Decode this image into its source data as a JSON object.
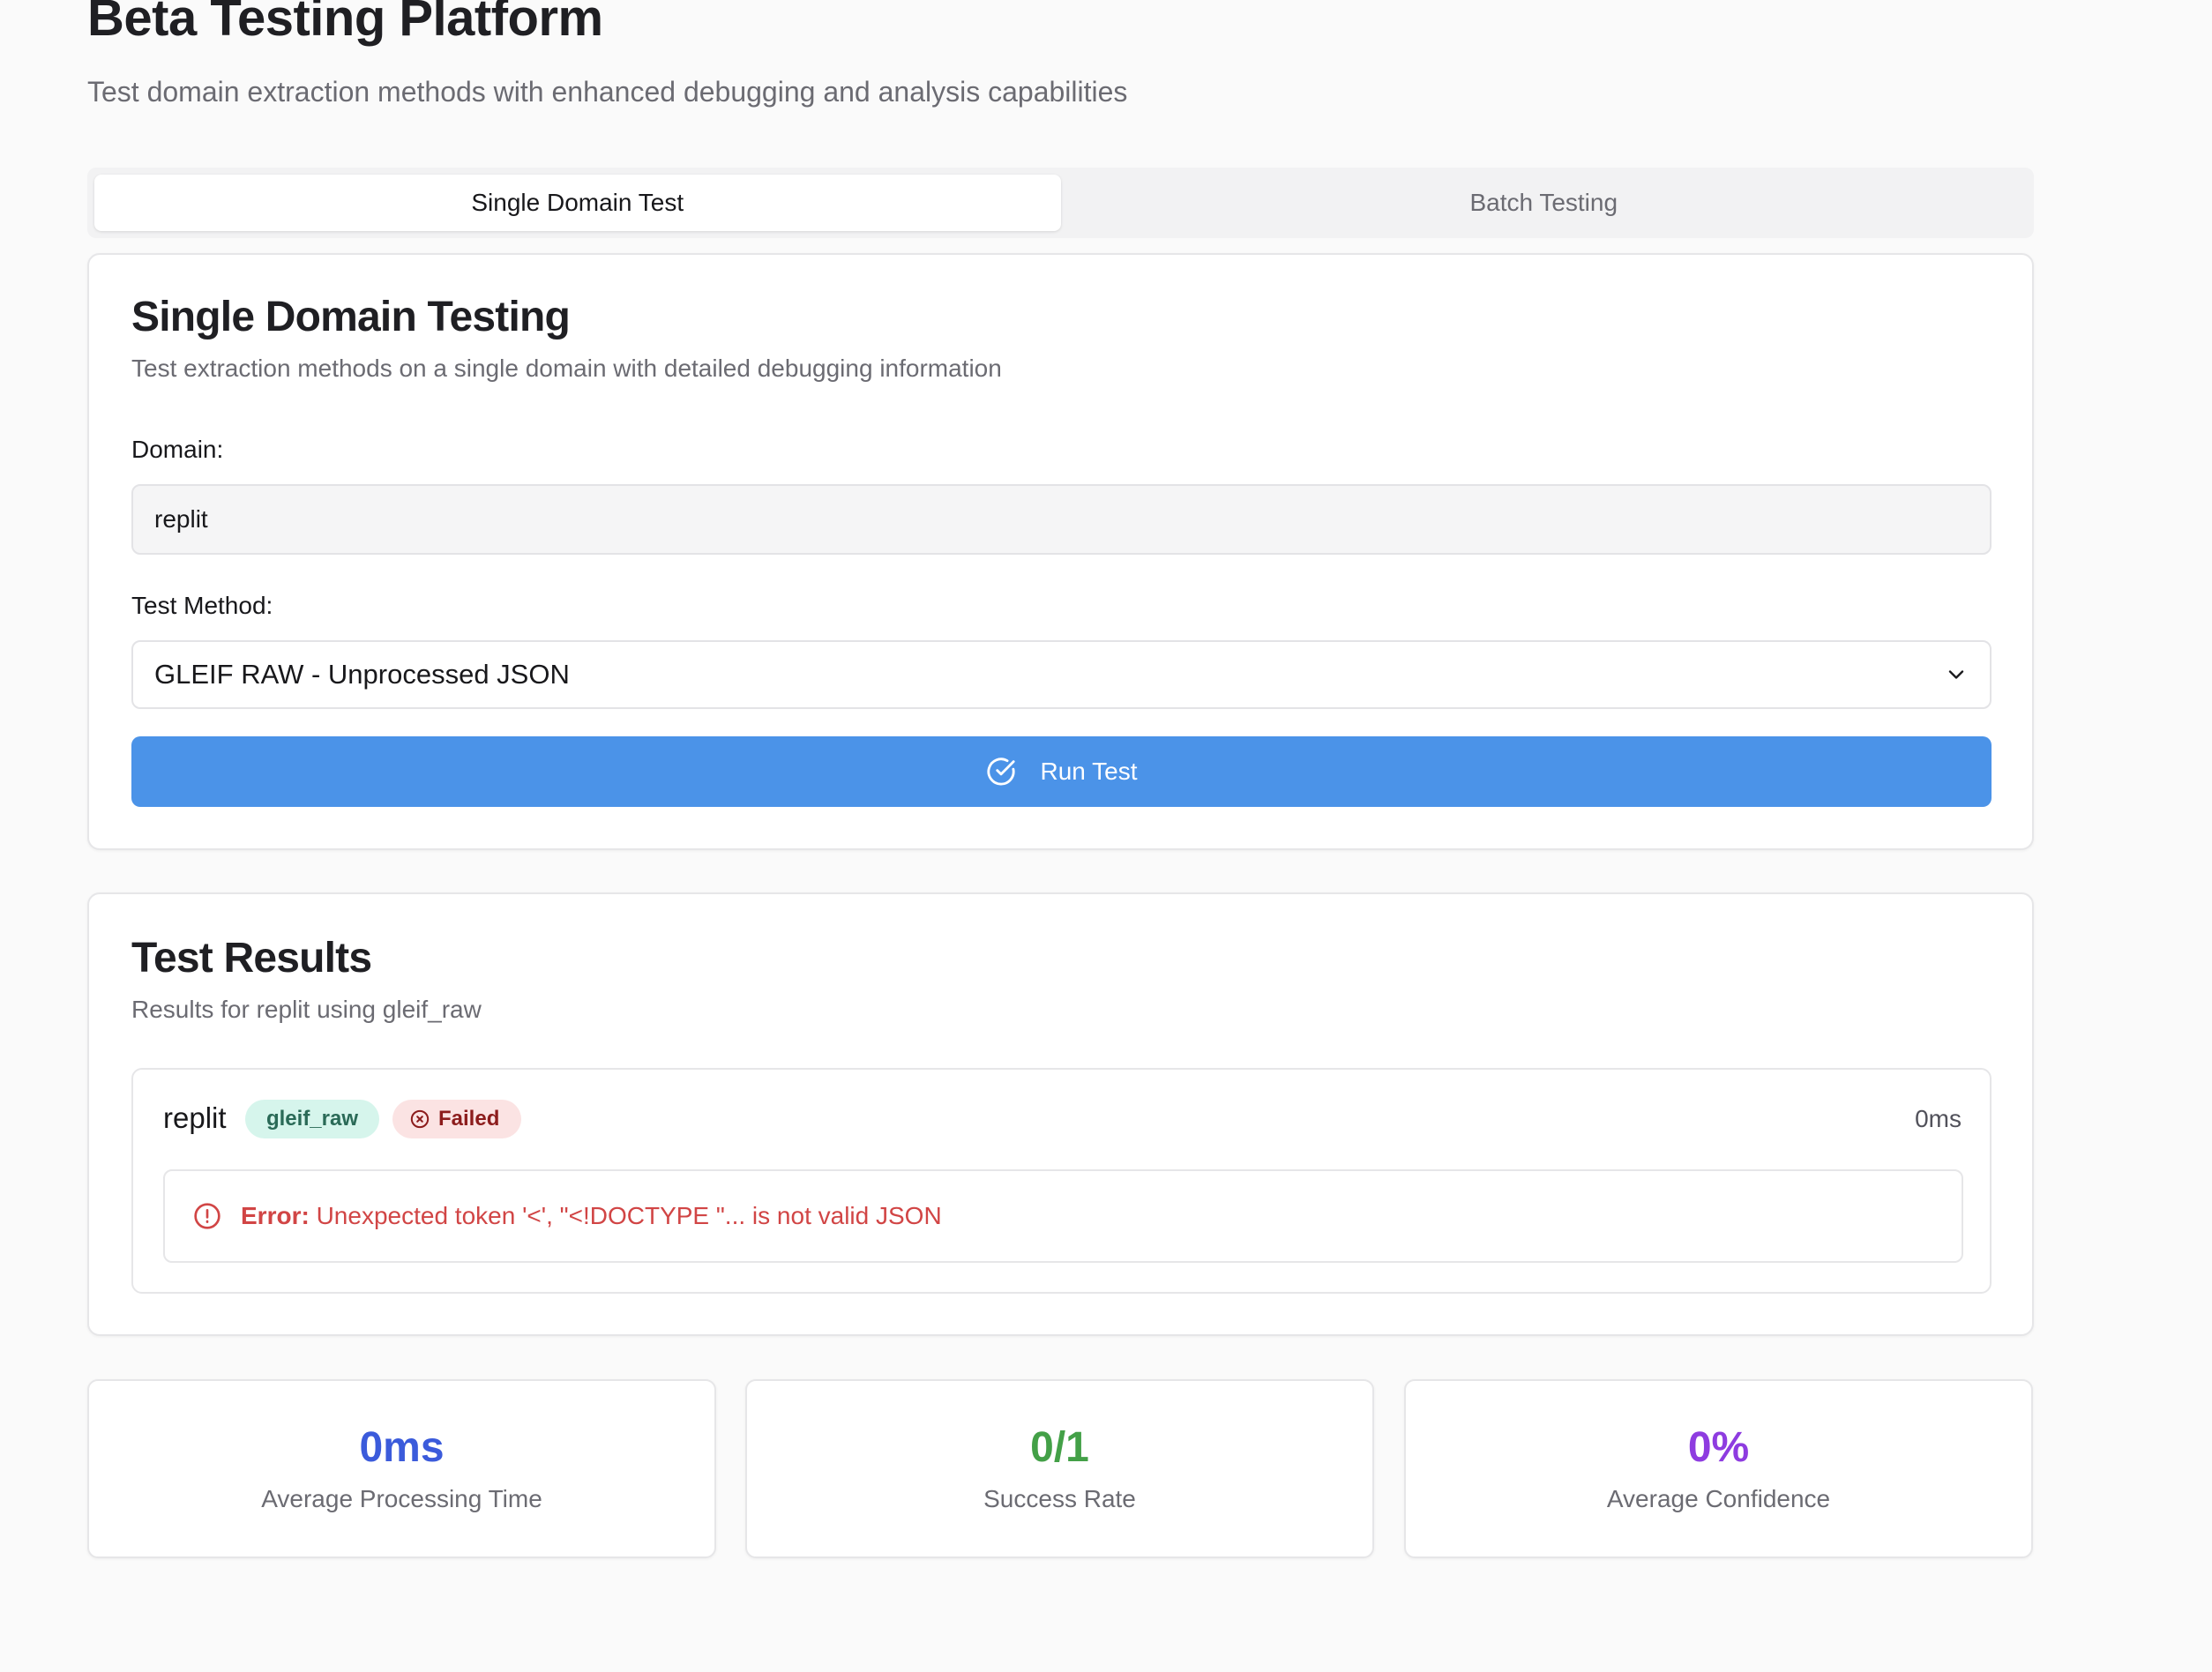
{
  "header": {
    "title": "Beta Testing Platform",
    "subtitle": "Test domain extraction methods with enhanced debugging and analysis capabilities"
  },
  "tabs": [
    {
      "label": "Single Domain Test",
      "active": true
    },
    {
      "label": "Batch Testing",
      "active": false
    }
  ],
  "single_test": {
    "title": "Single Domain Testing",
    "description": "Test extraction methods on a single domain with detailed debugging information",
    "domain_label": "Domain:",
    "domain_value": "replit",
    "method_label": "Test Method:",
    "method_value": "GLEIF RAW - Unprocessed JSON",
    "run_label": "Run Test"
  },
  "results": {
    "title": "Test Results",
    "description": "Results for replit using gleif_raw",
    "item": {
      "domain": "replit",
      "method": "gleif_raw",
      "status": "Failed",
      "time": "0ms",
      "error_prefix": "Error:",
      "error_message": "Unexpected token '<', \"<!DOCTYPE \"... is not valid JSON"
    }
  },
  "stats": [
    {
      "value": "0ms",
      "label": "Average Processing Time",
      "color": "#3b5bdb"
    },
    {
      "value": "0/1",
      "label": "Success Rate",
      "color": "#43a047"
    },
    {
      "value": "0%",
      "label": "Average Confidence",
      "color": "#8e3ce0"
    }
  ],
  "colors": {
    "primary_button": "#4b93e8",
    "error": "#d14545",
    "badge_method_bg": "#d6f5ec",
    "badge_failed_bg": "#fbe3e3"
  }
}
